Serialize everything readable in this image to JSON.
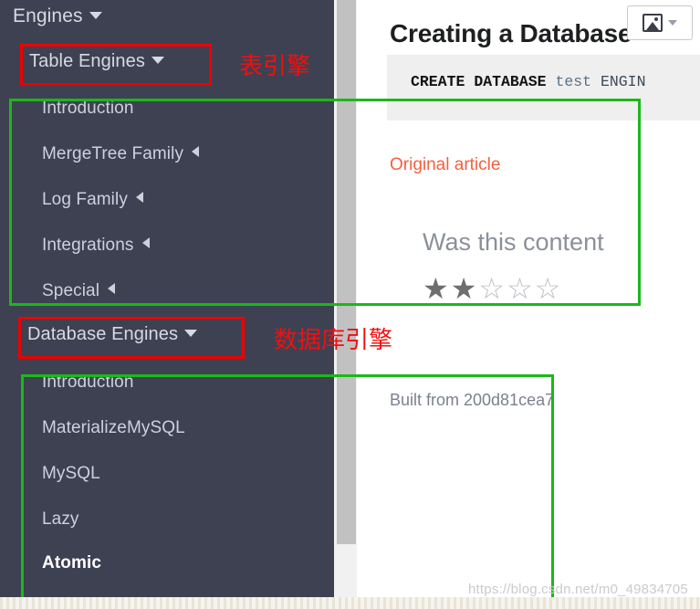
{
  "sidebar": {
    "background_color": "#3e4152",
    "header": {
      "label": "Engines",
      "caret": "chevron-down-icon"
    },
    "groups": [
      {
        "title": "Table Engines",
        "caret": "chevron-down-icon",
        "highlight_color": "#ee0000",
        "annotation": "表引擎",
        "items": [
          {
            "label": "Introduction",
            "has_caret": false,
            "active": false
          },
          {
            "label": "MergeTree Family",
            "has_caret": true,
            "active": false
          },
          {
            "label": "Log Family",
            "has_caret": true,
            "active": false
          },
          {
            "label": "Integrations",
            "has_caret": true,
            "active": false
          },
          {
            "label": "Special",
            "has_caret": true,
            "active": false
          }
        ]
      },
      {
        "title": "Database Engines",
        "caret": "chevron-down-icon",
        "highlight_color": "#ee0000",
        "annotation": "数据库引擎",
        "items": [
          {
            "label": "Introduction",
            "has_caret": false,
            "active": false
          },
          {
            "label": "MaterializeMySQL",
            "has_caret": false,
            "active": false
          },
          {
            "label": "MySQL",
            "has_caret": false,
            "active": false
          },
          {
            "label": "Lazy",
            "has_caret": false,
            "active": false
          },
          {
            "label": "Atomic",
            "has_caret": false,
            "active": true
          }
        ]
      }
    ]
  },
  "scrollbar": {
    "orientation": "vertical",
    "thumb_color": "#c1c1c1",
    "track_color": "#f1f1f1"
  },
  "content": {
    "title": "Creating a Database",
    "image_placeholder": {
      "icon": "broken-image-icon",
      "caret": "chevron-down-icon"
    },
    "code_block": {
      "keyword1": "CREATE",
      "keyword2": "DATABASE",
      "identifier": "test",
      "trailing": "ENGIN",
      "full_text": "CREATE DATABASE test ENGIN"
    },
    "original_article_link": "Original article",
    "rating": {
      "question": "Was this content",
      "stars_total": 5,
      "stars_filled": 2,
      "filled_glyph": "★",
      "empty_glyph": "☆"
    },
    "built_from": "Built from 200d81cea7"
  },
  "annotations": {
    "color_red": "#ee0000",
    "color_green": "#1ab81a",
    "label_table_engines": "表引擎",
    "label_database_engines": "数据库引擎"
  },
  "watermark": "https://blog.csdn.net/m0_49834705"
}
